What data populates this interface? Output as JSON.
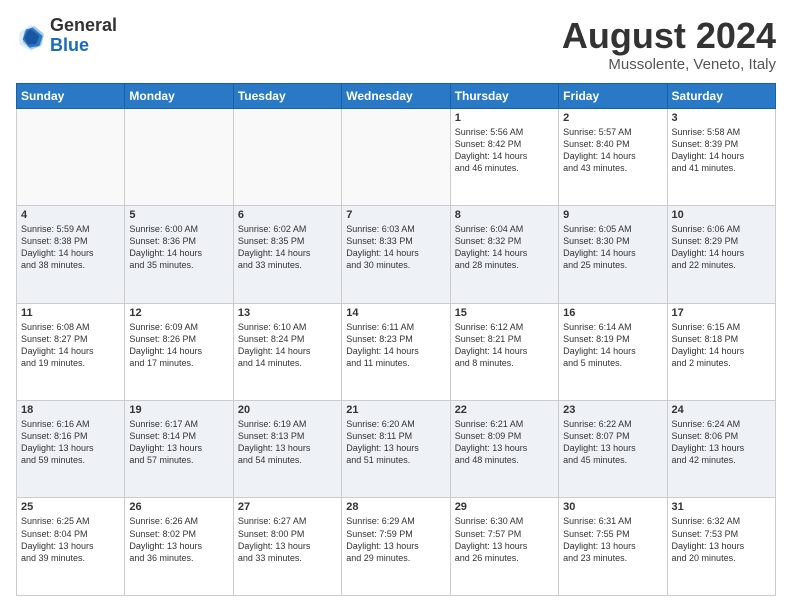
{
  "header": {
    "logo_general": "General",
    "logo_blue": "Blue",
    "month_year": "August 2024",
    "location": "Mussolente, Veneto, Italy"
  },
  "days_of_week": [
    "Sunday",
    "Monday",
    "Tuesday",
    "Wednesday",
    "Thursday",
    "Friday",
    "Saturday"
  ],
  "weeks": [
    [
      {
        "day": "",
        "info": ""
      },
      {
        "day": "",
        "info": ""
      },
      {
        "day": "",
        "info": ""
      },
      {
        "day": "",
        "info": ""
      },
      {
        "day": "1",
        "info": "Sunrise: 5:56 AM\nSunset: 8:42 PM\nDaylight: 14 hours\nand 46 minutes."
      },
      {
        "day": "2",
        "info": "Sunrise: 5:57 AM\nSunset: 8:40 PM\nDaylight: 14 hours\nand 43 minutes."
      },
      {
        "day": "3",
        "info": "Sunrise: 5:58 AM\nSunset: 8:39 PM\nDaylight: 14 hours\nand 41 minutes."
      }
    ],
    [
      {
        "day": "4",
        "info": "Sunrise: 5:59 AM\nSunset: 8:38 PM\nDaylight: 14 hours\nand 38 minutes."
      },
      {
        "day": "5",
        "info": "Sunrise: 6:00 AM\nSunset: 8:36 PM\nDaylight: 14 hours\nand 35 minutes."
      },
      {
        "day": "6",
        "info": "Sunrise: 6:02 AM\nSunset: 8:35 PM\nDaylight: 14 hours\nand 33 minutes."
      },
      {
        "day": "7",
        "info": "Sunrise: 6:03 AM\nSunset: 8:33 PM\nDaylight: 14 hours\nand 30 minutes."
      },
      {
        "day": "8",
        "info": "Sunrise: 6:04 AM\nSunset: 8:32 PM\nDaylight: 14 hours\nand 28 minutes."
      },
      {
        "day": "9",
        "info": "Sunrise: 6:05 AM\nSunset: 8:30 PM\nDaylight: 14 hours\nand 25 minutes."
      },
      {
        "day": "10",
        "info": "Sunrise: 6:06 AM\nSunset: 8:29 PM\nDaylight: 14 hours\nand 22 minutes."
      }
    ],
    [
      {
        "day": "11",
        "info": "Sunrise: 6:08 AM\nSunset: 8:27 PM\nDaylight: 14 hours\nand 19 minutes."
      },
      {
        "day": "12",
        "info": "Sunrise: 6:09 AM\nSunset: 8:26 PM\nDaylight: 14 hours\nand 17 minutes."
      },
      {
        "day": "13",
        "info": "Sunrise: 6:10 AM\nSunset: 8:24 PM\nDaylight: 14 hours\nand 14 minutes."
      },
      {
        "day": "14",
        "info": "Sunrise: 6:11 AM\nSunset: 8:23 PM\nDaylight: 14 hours\nand 11 minutes."
      },
      {
        "day": "15",
        "info": "Sunrise: 6:12 AM\nSunset: 8:21 PM\nDaylight: 14 hours\nand 8 minutes."
      },
      {
        "day": "16",
        "info": "Sunrise: 6:14 AM\nSunset: 8:19 PM\nDaylight: 14 hours\nand 5 minutes."
      },
      {
        "day": "17",
        "info": "Sunrise: 6:15 AM\nSunset: 8:18 PM\nDaylight: 14 hours\nand 2 minutes."
      }
    ],
    [
      {
        "day": "18",
        "info": "Sunrise: 6:16 AM\nSunset: 8:16 PM\nDaylight: 13 hours\nand 59 minutes."
      },
      {
        "day": "19",
        "info": "Sunrise: 6:17 AM\nSunset: 8:14 PM\nDaylight: 13 hours\nand 57 minutes."
      },
      {
        "day": "20",
        "info": "Sunrise: 6:19 AM\nSunset: 8:13 PM\nDaylight: 13 hours\nand 54 minutes."
      },
      {
        "day": "21",
        "info": "Sunrise: 6:20 AM\nSunset: 8:11 PM\nDaylight: 13 hours\nand 51 minutes."
      },
      {
        "day": "22",
        "info": "Sunrise: 6:21 AM\nSunset: 8:09 PM\nDaylight: 13 hours\nand 48 minutes."
      },
      {
        "day": "23",
        "info": "Sunrise: 6:22 AM\nSunset: 8:07 PM\nDaylight: 13 hours\nand 45 minutes."
      },
      {
        "day": "24",
        "info": "Sunrise: 6:24 AM\nSunset: 8:06 PM\nDaylight: 13 hours\nand 42 minutes."
      }
    ],
    [
      {
        "day": "25",
        "info": "Sunrise: 6:25 AM\nSunset: 8:04 PM\nDaylight: 13 hours\nand 39 minutes."
      },
      {
        "day": "26",
        "info": "Sunrise: 6:26 AM\nSunset: 8:02 PM\nDaylight: 13 hours\nand 36 minutes."
      },
      {
        "day": "27",
        "info": "Sunrise: 6:27 AM\nSunset: 8:00 PM\nDaylight: 13 hours\nand 33 minutes."
      },
      {
        "day": "28",
        "info": "Sunrise: 6:29 AM\nSunset: 7:59 PM\nDaylight: 13 hours\nand 29 minutes."
      },
      {
        "day": "29",
        "info": "Sunrise: 6:30 AM\nSunset: 7:57 PM\nDaylight: 13 hours\nand 26 minutes."
      },
      {
        "day": "30",
        "info": "Sunrise: 6:31 AM\nSunset: 7:55 PM\nDaylight: 13 hours\nand 23 minutes."
      },
      {
        "day": "31",
        "info": "Sunrise: 6:32 AM\nSunset: 7:53 PM\nDaylight: 13 hours\nand 20 minutes."
      }
    ]
  ]
}
